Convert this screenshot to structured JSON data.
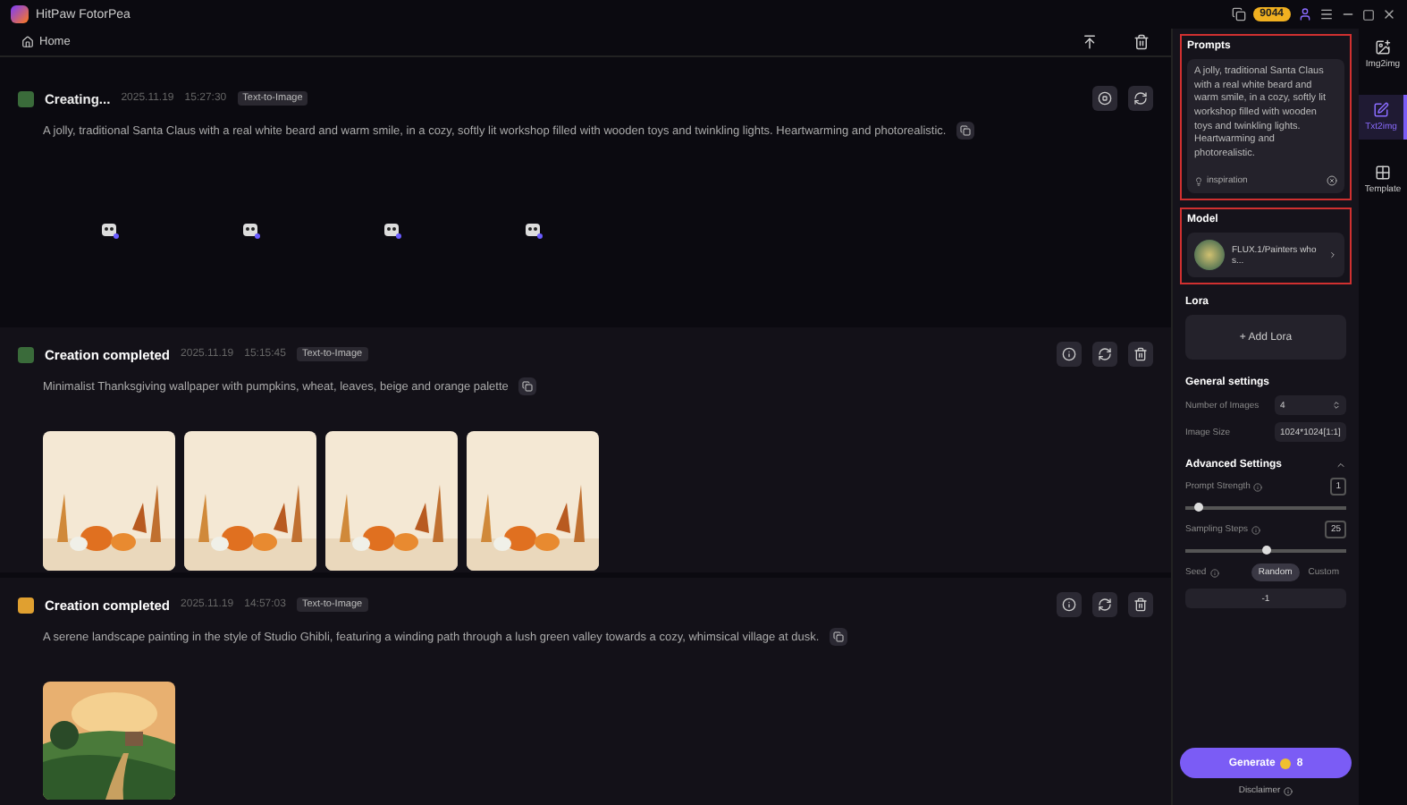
{
  "app": {
    "title": "HitPaw FotorPea",
    "coins": "9044"
  },
  "nav": {
    "home": "Home"
  },
  "tasks": [
    {
      "status": "Creating...",
      "done": false,
      "date": "2025.11.19",
      "time": "15:27:30",
      "tag": "Text-to-Image",
      "prompt": "A jolly, traditional Santa Claus with a real white beard and warm smile, in a cozy, softly lit workshop filled with wooden toys and twinkling lights. Heartwarming and photorealistic.",
      "color": "#3a6b3a",
      "images": [
        {
          "kind": "loading"
        },
        {
          "kind": "loading"
        },
        {
          "kind": "loading"
        },
        {
          "kind": "loading"
        }
      ]
    },
    {
      "status": "Creation completed",
      "done": true,
      "date": "2025.11.19",
      "time": "15:15:45",
      "tag": "Text-to-Image",
      "prompt": "Minimalist Thanksgiving wallpaper with pumpkins, wheat, leaves, beige and orange palette",
      "color": "#3a6b3a"
    },
    {
      "status": "Creation completed",
      "done": true,
      "date": "2025.11.19",
      "time": "14:57:03",
      "tag": "Text-to-Image",
      "prompt": "A serene landscape painting in the style of Studio Ghibli, featuring a winding path through a lush green valley towards a cozy, whimsical village at dusk.",
      "color": "#e0a030"
    }
  ],
  "panel": {
    "prompts_title": "Prompts",
    "prompt": "A jolly, traditional Santa Claus with a real white beard and warm smile, in a cozy, softly lit workshop filled with wooden toys and twinkling lights. Heartwarming and photorealistic.",
    "inspiration": "inspiration",
    "model_title": "Model",
    "model": "FLUX.1/Painters who s...",
    "lora_title": "Lora",
    "add_lora": "+ Add Lora",
    "general_title": "General settings",
    "num_images_label": "Number of Images",
    "num_images": "4",
    "size_label": "Image Size",
    "size": "1024*1024[1:1]",
    "advanced_title": "Advanced Settings",
    "sliders": [
      {
        "label": "Prompt Strength",
        "value": "1",
        "level": 0.08
      },
      {
        "label": "Sampling Steps",
        "value": "25",
        "level": 0.5
      }
    ],
    "seed_label": "Seed",
    "seed_modes": [
      {
        "label": "Random",
        "selected": true
      },
      {
        "label": "Custom",
        "selected": false
      }
    ],
    "seed": "-1",
    "generate": "Generate",
    "cost": "8",
    "disclaimer": "Disclaimer"
  },
  "rail": [
    {
      "label": "Img2img",
      "selected": false
    },
    {
      "label": "Txt2img",
      "selected": true
    },
    {
      "label": "Template",
      "selected": false
    }
  ]
}
